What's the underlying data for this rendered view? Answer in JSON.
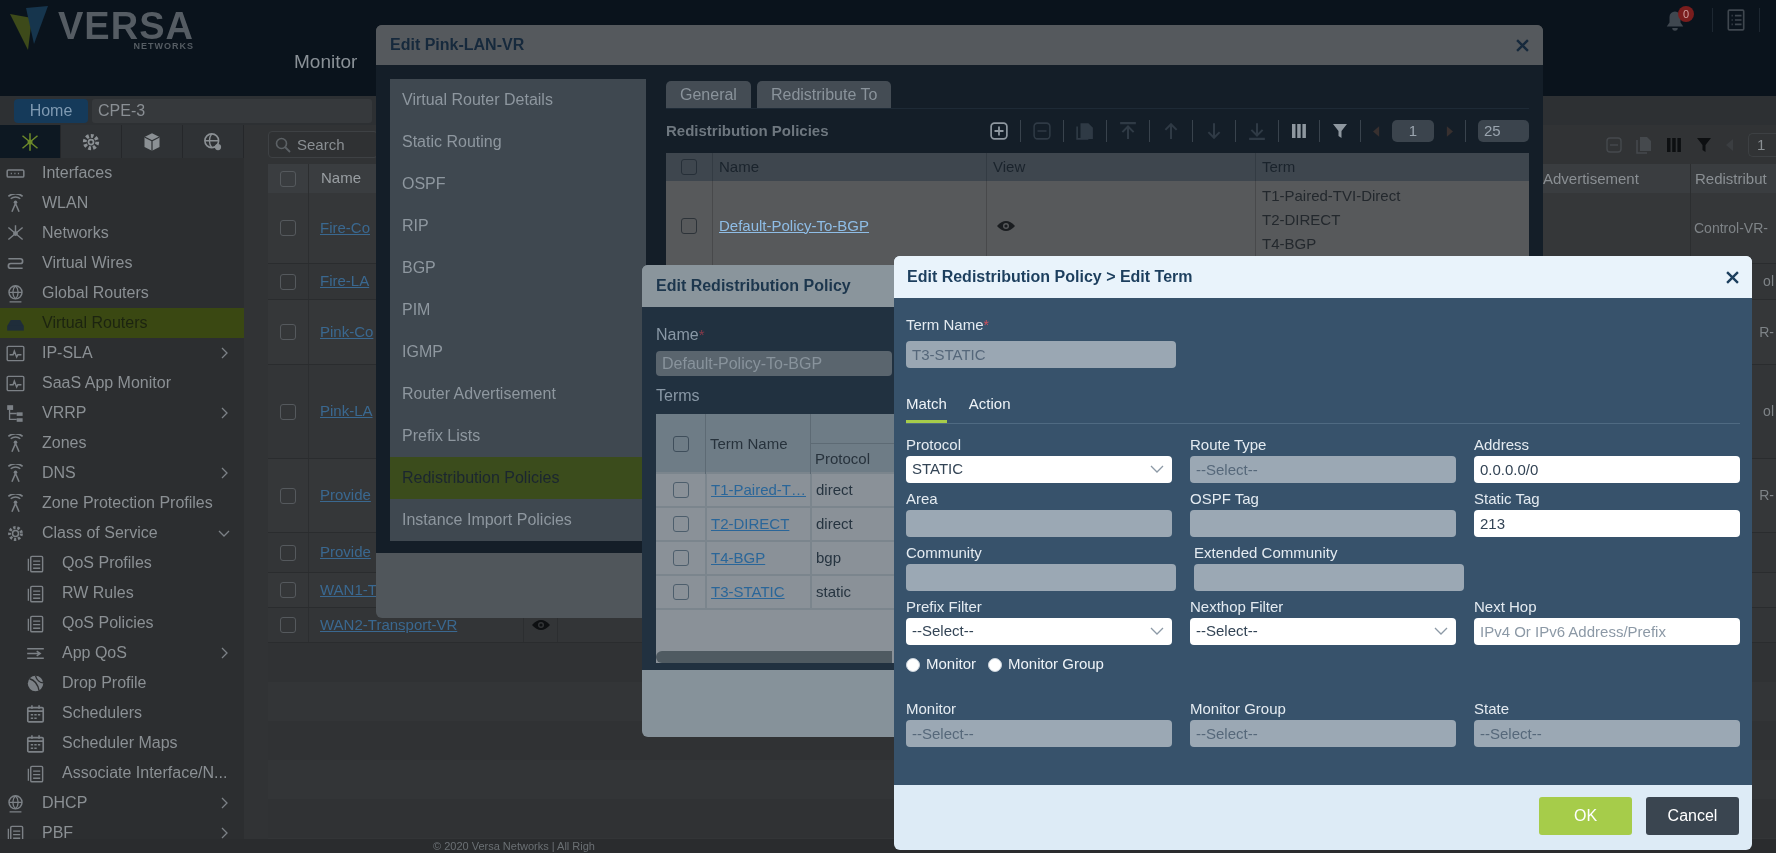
{
  "header": {
    "logo_word": "VERSA",
    "logo_tagline": "NETWORKS",
    "nav": "Monitor",
    "notifications": "0"
  },
  "breadcrumb": {
    "home": "Home",
    "device": "CPE-3"
  },
  "sidebar": {
    "icon_tabs": [
      {
        "selected": true
      },
      {
        "selected": false
      },
      {
        "selected": false
      },
      {
        "selected": false
      }
    ],
    "items": [
      {
        "label": "Interfaces",
        "kind": "item",
        "selected": false
      },
      {
        "label": "WLAN",
        "kind": "item",
        "selected": false
      },
      {
        "label": "Networks",
        "kind": "item",
        "selected": false
      },
      {
        "label": "Virtual Wires",
        "kind": "item",
        "selected": false
      },
      {
        "label": "Global Routers",
        "kind": "item",
        "selected": false
      },
      {
        "label": "Virtual Routers",
        "kind": "item",
        "selected": true
      },
      {
        "label": "IP-SLA",
        "kind": "group",
        "selected": false,
        "expanded": false
      },
      {
        "label": "SaaS App Monitor",
        "kind": "item",
        "selected": false
      },
      {
        "label": "VRRP",
        "kind": "group",
        "selected": false,
        "expanded": false
      },
      {
        "label": "Zones",
        "kind": "item",
        "selected": false
      },
      {
        "label": "DNS",
        "kind": "group",
        "selected": false,
        "expanded": false
      },
      {
        "label": "Zone Protection Profiles",
        "kind": "item",
        "selected": false
      },
      {
        "label": "Class of Service",
        "kind": "group",
        "selected": false,
        "expanded": true,
        "children": [
          {
            "label": "QoS Profiles",
            "kind": "item",
            "selected": false
          },
          {
            "label": "RW Rules",
            "kind": "item",
            "selected": false
          },
          {
            "label": "QoS Policies",
            "kind": "item",
            "selected": false
          },
          {
            "label": "App QoS",
            "kind": "group",
            "selected": false,
            "expanded": false
          },
          {
            "label": "Drop Profile",
            "kind": "item",
            "selected": false
          },
          {
            "label": "Schedulers",
            "kind": "item",
            "selected": false
          },
          {
            "label": "Scheduler Maps",
            "kind": "item",
            "selected": false
          },
          {
            "label": "Associate Interface/N...",
            "kind": "item",
            "selected": false
          }
        ]
      },
      {
        "label": "DHCP",
        "kind": "group",
        "selected": false,
        "expanded": false
      },
      {
        "label": "PBF",
        "kind": "group",
        "selected": false,
        "expanded": false
      }
    ]
  },
  "content": {
    "search": {
      "placeholder": "Search"
    },
    "page": "1",
    "table": {
      "columns": [
        "Name",
        "Advertisement",
        "Redistribut"
      ],
      "header_checked": false,
      "rows": [
        {
          "checked": false,
          "name": "Fire-Co",
          "redistribute": "Control-VR-"
        },
        {
          "checked": false,
          "name": "Fire-LA",
          "redistribute": "ol"
        },
        {
          "checked": false,
          "name": "Pink-Co",
          "redistribute": "R-"
        },
        {
          "checked": false,
          "name": "Pink-LA",
          "redistribute": "ol"
        },
        {
          "checked": false,
          "name": "Provide",
          "redistribute": "R-"
        },
        {
          "checked": false,
          "name": "Provide"
        },
        {
          "checked": false,
          "name": "WAN1-T"
        },
        {
          "checked": false,
          "name": "WAN2-Transport-VR",
          "view_icon": true
        }
      ]
    },
    "footer": "© 2020 Versa Networks | All Righ"
  },
  "vr_dialog": {
    "title": "Edit Pink-LAN-VR",
    "menu": [
      {
        "label": "Virtual Router Details",
        "selected": false
      },
      {
        "label": "Static Routing",
        "selected": false
      },
      {
        "label": "OSPF",
        "selected": false
      },
      {
        "label": "RIP",
        "selected": false
      },
      {
        "label": "BGP",
        "selected": false
      },
      {
        "label": "PIM",
        "selected": false
      },
      {
        "label": "IGMP",
        "selected": false
      },
      {
        "label": "Router Advertisement",
        "selected": false
      },
      {
        "label": "Prefix Lists",
        "selected": false
      },
      {
        "label": "Redistribution Policies",
        "selected": true
      },
      {
        "label": "Instance Import Policies",
        "selected": false
      }
    ],
    "tabs": [
      "General",
      "Redistribute To"
    ],
    "section_title": "Redistribution Policies",
    "page": "1",
    "page_size": "25",
    "table": {
      "columns": [
        "Name",
        "View",
        "Term"
      ],
      "header_checked": false,
      "rows": [
        {
          "checked": false,
          "name": "Default-Policy-To-BGP",
          "terms": [
            "T1-Paired-TVI-Direct",
            "T2-DIRECT",
            "T4-BGP"
          ]
        }
      ]
    }
  },
  "policy_dialog": {
    "title": "Edit Redistribution Policy",
    "name_label": "Name",
    "required_mark": "*",
    "name_value": "Default-Policy-To-BGP",
    "terms_label": "Terms",
    "columns": [
      "Term Name",
      "Protocol"
    ],
    "header_checked": false,
    "rows": [
      {
        "checked": false,
        "name": "T1-Paired-T…",
        "protocol": "direct"
      },
      {
        "checked": false,
        "name": "T2-DIRECT",
        "protocol": "direct"
      },
      {
        "checked": false,
        "name": "T4-BGP",
        "protocol": "bgp"
      },
      {
        "checked": false,
        "name": "T3-STATIC",
        "protocol": "static"
      }
    ]
  },
  "term_dialog": {
    "title": "Edit Redistribution Policy > Edit Term",
    "term_name_label": "Term Name",
    "required_mark": "*",
    "term_name": "T3-STATIC",
    "tabs": [
      {
        "label": "Match",
        "selected": true
      },
      {
        "label": "Action",
        "selected": false
      }
    ],
    "field_rows": [
      [
        {
          "label": "Protocol",
          "kind": "select",
          "value": "STATIC"
        },
        {
          "label": "Route Type",
          "kind": "disabled",
          "value": "--Select--"
        },
        {
          "label": "Address",
          "kind": "input",
          "value": "0.0.0.0/0"
        }
      ],
      [
        {
          "label": "Area",
          "kind": "disabled"
        },
        {
          "label": "OSPF Tag",
          "kind": "disabled"
        },
        {
          "label": "Static Tag",
          "kind": "input",
          "value": "213"
        }
      ],
      [
        {
          "label": "Community",
          "kind": "disabled"
        },
        {
          "label": "Extended Community",
          "kind": "disabled"
        }
      ],
      [
        {
          "label": "Prefix Filter",
          "kind": "select",
          "value": "--Select--"
        },
        {
          "label": "Nexthop Filter",
          "kind": "select",
          "value": "--Select--"
        },
        {
          "label": "Next Hop",
          "kind": "input",
          "placeholder": "IPv4 Or IPv6 Address/Prefix"
        }
      ]
    ],
    "radios": [
      {
        "label": "Monitor",
        "selected": false
      },
      {
        "label": "Monitor Group",
        "selected": false
      }
    ],
    "monitor_fields": [
      {
        "label": "Monitor",
        "kind": "disabled",
        "value": "--Select--"
      },
      {
        "label": "Monitor Group",
        "kind": "disabled",
        "value": "--Select--"
      },
      {
        "label": "State",
        "kind": "disabled",
        "value": "--Select--"
      }
    ],
    "buttons": [
      {
        "label": "OK",
        "kind": "primary"
      },
      {
        "label": "Cancel",
        "kind": "secondary"
      }
    ]
  }
}
